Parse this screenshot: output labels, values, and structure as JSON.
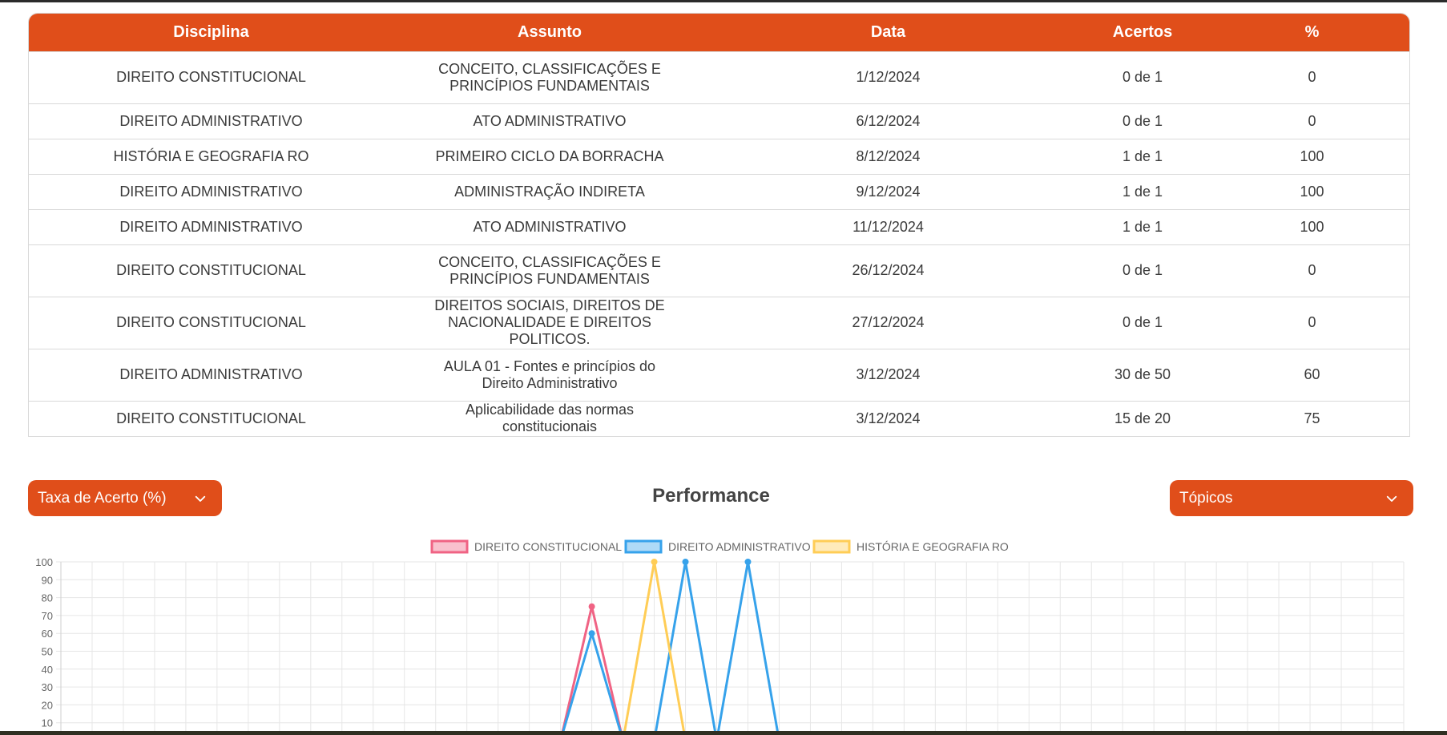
{
  "table": {
    "headers": [
      "Disciplina",
      "Assunto",
      "Data",
      "Acertos",
      "%"
    ],
    "rows": [
      {
        "disciplina": "DIREITO CONSTITUCIONAL",
        "assunto": "CONCEITO, CLASSIFICAÇÕES E PRINCÍPIOS FUNDAMENTAIS",
        "data": "1/12/2024",
        "acertos": "0 de 1",
        "pct": "0"
      },
      {
        "disciplina": "DIREITO ADMINISTRATIVO",
        "assunto": "ATO ADMINISTRATIVO",
        "data": "6/12/2024",
        "acertos": "0 de 1",
        "pct": "0"
      },
      {
        "disciplina": "HISTÓRIA E GEOGRAFIA RO",
        "assunto": "PRIMEIRO CICLO DA BORRACHA",
        "data": "8/12/2024",
        "acertos": "1 de 1",
        "pct": "100"
      },
      {
        "disciplina": "DIREITO ADMINISTRATIVO",
        "assunto": "ADMINISTRAÇÃO INDIRETA",
        "data": "9/12/2024",
        "acertos": "1 de 1",
        "pct": "100"
      },
      {
        "disciplina": "DIREITO ADMINISTRATIVO",
        "assunto": "ATO ADMINISTRATIVO",
        "data": "11/12/2024",
        "acertos": "1 de 1",
        "pct": "100"
      },
      {
        "disciplina": "DIREITO CONSTITUCIONAL",
        "assunto": "CONCEITO, CLASSIFICAÇÕES E PRINCÍPIOS FUNDAMENTAIS",
        "data": "26/12/2024",
        "acertos": "0 de 1",
        "pct": "0"
      },
      {
        "disciplina": "DIREITO CONSTITUCIONAL",
        "assunto": "DIREITOS SOCIAIS, DIREITOS DE NACIONALIDADE E DIREITOS POLITICOS.",
        "data": "27/12/2024",
        "acertos": "0 de 1",
        "pct": "0"
      },
      {
        "disciplina": "DIREITO ADMINISTRATIVO",
        "assunto": "AULA 01 - Fontes e princípios do Direito Administrativo",
        "data": "3/12/2024",
        "acertos": "30 de 50",
        "pct": "60"
      },
      {
        "disciplina": "DIREITO CONSTITUCIONAL",
        "assunto": "Aplicabilidade das normas constitucionais",
        "data": "3/12/2024",
        "acertos": "15 de 20",
        "pct": "75"
      }
    ]
  },
  "controls": {
    "metric_dropdown": "Taxa de Acerto (%)",
    "performance_title": "Performance",
    "grouping_dropdown": "Tópicos"
  },
  "colors": {
    "accent": "#e04e1a",
    "constitucional": "#f06384",
    "administrativo": "#36a2eb",
    "historia": "#ffcd56"
  },
  "chart_data": {
    "type": "line",
    "ylim": [
      0,
      100
    ],
    "y_ticks": [
      10,
      20,
      30,
      40,
      50,
      60,
      70,
      80,
      90,
      100
    ],
    "x_count": 44,
    "grid": true,
    "legend_position": "top",
    "series": [
      {
        "name": "DIREITO CONSTITUCIONAL",
        "color": "#f06384",
        "points": [
          {
            "x": 16,
            "y": 0
          },
          {
            "x": 17,
            "y": 75
          },
          {
            "x": 18,
            "y": 0
          }
        ]
      },
      {
        "name": "DIREITO ADMINISTRATIVO",
        "color": "#36a2eb",
        "points": [
          {
            "x": 16,
            "y": 0
          },
          {
            "x": 17,
            "y": 60
          },
          {
            "x": 18,
            "y": 0
          },
          {
            "x": 19,
            "y": 0
          },
          {
            "x": 20,
            "y": 100
          },
          {
            "x": 21,
            "y": 0
          },
          {
            "x": 22,
            "y": 100
          },
          {
            "x": 23,
            "y": 0
          }
        ]
      },
      {
        "name": "HISTÓRIA E GEOGRAFIA RO",
        "color": "#ffcd56",
        "points": [
          {
            "x": 18,
            "y": 0
          },
          {
            "x": 19,
            "y": 100
          },
          {
            "x": 20,
            "y": 0
          }
        ]
      }
    ]
  }
}
